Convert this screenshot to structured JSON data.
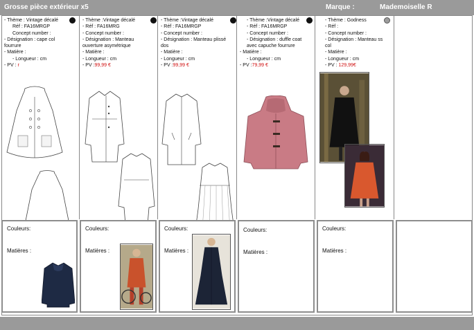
{
  "header": {
    "title": "Grosse pièce extérieur x5",
    "brand_label": "Marque :",
    "brand": "Mademoiselle R"
  },
  "colors": {
    "header_bg": "#9a9a9a",
    "price_red": "#d01010",
    "coat_pink": "#c97b85",
    "coat_orange": "#d9582e",
    "coat_navy": "#1e2a44"
  },
  "columns": [
    {
      "lines": [
        "- Thème : Vintage décalé",
        "Réf : FA16MRGP",
        "Concept number :",
        "- Désignation : cape col fourrure",
        "- Matière :",
        "- Longueur : cm"
      ],
      "pv_label": "- PV : ",
      "pv_value": "r",
      "bottom": {
        "couleurs": "Couleurs:",
        "matieres": "Matières :"
      }
    },
    {
      "lines": [
        "- Thème :Vintage décalé",
        "- Réf : FA16MRG",
        "- Concept number :",
        "- Désignation : Manteau ouverture asymétrique",
        "- Matière :",
        "- Longueur : cm"
      ],
      "pv_label": "- PV :",
      "pv_value": "99,99 €",
      "bottom": {
        "couleurs": "Couleurs:",
        "matieres": "Matières :"
      }
    },
    {
      "lines": [
        "- Thème :Vintage décalé",
        "- Réf : FA16MRGP",
        "- Concept number :",
        "- Désignation : Manteau plissé dos",
        "- Matière :",
        "- Longueur : cm"
      ],
      "pv_label": "- PV :",
      "pv_value": "99,99 €",
      "bottom": {
        "couleurs": "Couleurs:",
        "matieres": "Matières :"
      }
    },
    {
      "lines": [
        "- Thème :Vintage décalé",
        "- Réf : FA16MRGP",
        "- Concept number :",
        "- Désignation : duffle coat avec capuche fourrure",
        "- Matière :",
        "- Longueur : cm"
      ],
      "pv_label": "- PV :",
      "pv_value": "79,99 €",
      "bottom": {
        "couleurs": "Couleurs:",
        "matieres": "Matières :"
      }
    },
    {
      "lines": [
        "- Thème : Godness",
        "- Réf :",
        "- Concept number :",
        "- Désignation : Manteau ss col",
        "- Matière :",
        "- Longueur : cm"
      ],
      "pv_label": "- PV : ",
      "pv_value": "129,99€",
      "bottom": {
        "couleurs": "Couleurs:",
        "matieres": "Matières :"
      }
    }
  ]
}
